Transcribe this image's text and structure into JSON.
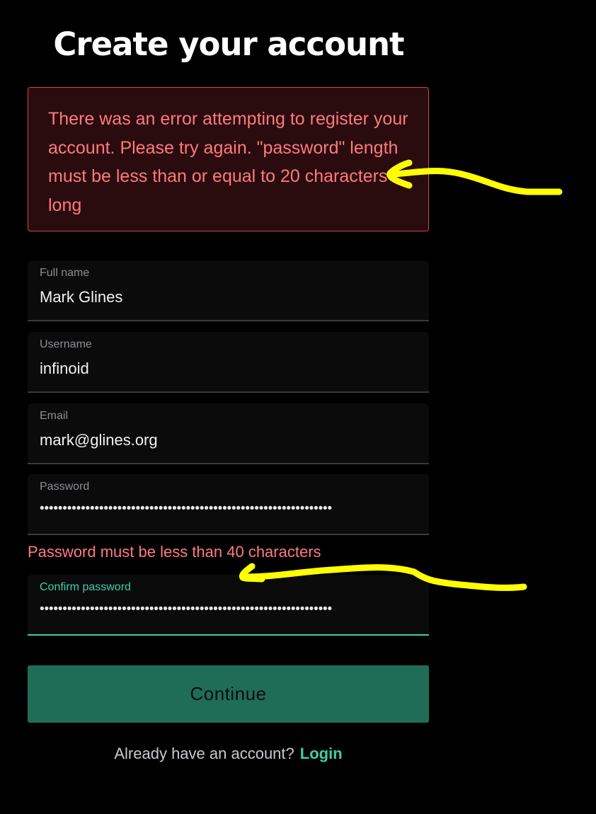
{
  "header": {
    "title": "Create your account"
  },
  "error_banner": {
    "message": "There was an error attempting to register your account. Please try again. \"password\" length must be less than or equal to 20 characters long"
  },
  "form": {
    "full_name": {
      "label": "Full name",
      "value": "Mark Glines"
    },
    "username": {
      "label": "Username",
      "value": "infinoid"
    },
    "email": {
      "label": "Email",
      "value": "mark@glines.org"
    },
    "password": {
      "label": "Password",
      "value": "••••••••••••••••••••••••••••••••••••••••••••••••••••••••••••••••"
    },
    "password_error": "Password must be less than 40 characters",
    "confirm_password": {
      "label": "Confirm password",
      "value": "••••••••••••••••••••••••••••••••••••••••••••••••••••••••••••••••"
    }
  },
  "actions": {
    "continue_label": "Continue"
  },
  "footer": {
    "prompt": "Already have an account?",
    "login_label": "Login"
  },
  "colors": {
    "background": "#000000",
    "error_text": "#ff7a7e",
    "error_background": "#2a0b0e",
    "accent": "#3fcfa5",
    "button": "#206d57",
    "annotation": "#ffff00"
  }
}
